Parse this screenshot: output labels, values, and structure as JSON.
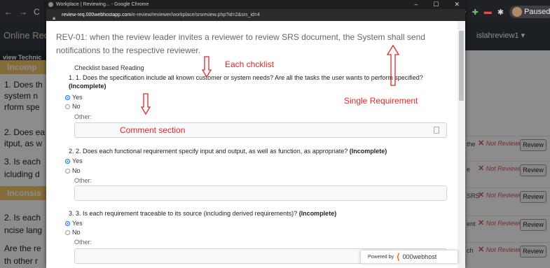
{
  "background_browser": {
    "nav_icons": [
      "back-icon",
      "forward-icon",
      "reload-icon"
    ],
    "nav_glyphs": [
      "←",
      "→",
      "C"
    ],
    "extension_profile_label": "Paused",
    "site_brand": "Online Req",
    "user_menu": "islahreview1 ▾",
    "strip_text": "view Technic",
    "left_rows": [
      {
        "text": "Incomp",
        "band": true
      },
      {
        "text": "1. Does th"
      },
      {
        "text": "system n"
      },
      {
        "text": "rform spe"
      },
      {
        "text": "2. Does ea"
      },
      {
        "text": "itput, as w"
      },
      {
        "text": "3. Is each"
      },
      {
        "text": "icluding d"
      },
      {
        "text": "Inconsis",
        "band": true
      },
      {
        "text": "2. Is each"
      },
      {
        "text": "ncise lang"
      },
      {
        "text": "Are the re"
      },
      {
        "text": "th other r"
      }
    ],
    "right_rows": [
      {
        "text": "the",
        "status_x": "✕",
        "status": "Not Reviewed",
        "button": "Review"
      },
      {
        "text": "e",
        "status_x": "✕",
        "status": "Not Reviewed",
        "button": "Review"
      },
      {
        "text": "SRS",
        "status_x": "✕",
        "status": "Not Reviewed",
        "button": "Review"
      },
      {
        "text": "ent",
        "status_x": "✕",
        "status": "Not Reviewed",
        "button": "Review"
      },
      {
        "text": "ch",
        "status_x": "✕",
        "status": "Not Reviewed",
        "button": "Review"
      }
    ]
  },
  "popup": {
    "window_title": "Workplace | Reviewing... - Google Chrome",
    "window_controls": [
      "–",
      "☐",
      "✕"
    ],
    "url_host": "review-req.000webhostapp.com",
    "url_path": "/e-review/reviewer/workplace/srsreview.php?id=2&srs_id=4",
    "requirement": "REV-01: when the review leader invites a reviewer to review SRS document, the System shall send notifications to the respective reviewer.",
    "section_title": "Checklist based Reading",
    "questions": [
      {
        "text": "1. 1. Does the specification include all known customer or system needs? Are all the tasks the user wants to perform specified?",
        "tag": "(Incomplete)",
        "yes": "Yes",
        "no": "No",
        "selected": "yes",
        "other": "Other:"
      },
      {
        "text": "2. 2. Does each functional requirement specify input and output, as well as function, as appropriate?",
        "tag": "(Incomplete)",
        "yes": "Yes",
        "no": "No",
        "selected": "yes",
        "other": "Other:"
      },
      {
        "text": "3. 3. Is each requirement traceable to its source (including derived requirements)?",
        "tag": "(Incomplete)",
        "yes": "Yes",
        "no": "No",
        "selected": "yes",
        "other": "Other:"
      }
    ],
    "annotations": {
      "each_checklist": "Each chcklist",
      "single_requirement": "Single Requirement",
      "comment_section": "Comment section"
    },
    "powered_by": "Powered by",
    "powered_brand": "000webhost"
  },
  "colors": {
    "annotation": "#e0262a",
    "link_blue": "#0d6efd",
    "not_reviewed": "#d9534f"
  }
}
